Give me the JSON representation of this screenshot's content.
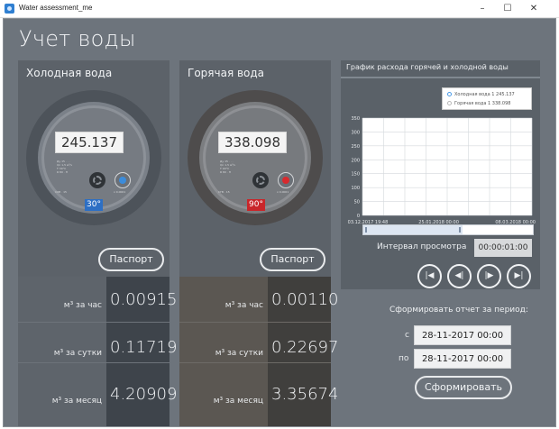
{
  "window": {
    "title": "Water assessment_me",
    "minimize": "–",
    "maximize": "☐",
    "close": "✕"
  },
  "page": {
    "title": "Учет воды"
  },
  "cold": {
    "title": "Холодная вода",
    "reading": "245.137",
    "temperature": "30°",
    "passport_label": "Паспорт",
    "stats": [
      {
        "label": "м³ за час",
        "value": "0.00915"
      },
      {
        "label": "м³ за сутки",
        "value": "0.11719"
      },
      {
        "label": "м³ за месяц",
        "value": "4.20909"
      }
    ]
  },
  "hot": {
    "title": "Горячая вода",
    "reading": "338.098",
    "temperature": "90°",
    "passport_label": "Паспорт",
    "stats": [
      {
        "label": "м³ за час",
        "value": "0.00110"
      },
      {
        "label": "м³ за сутки",
        "value": "0.22697"
      },
      {
        "label": "м³ за месяц",
        "value": "3.35674"
      }
    ]
  },
  "chart_data": {
    "type": "line",
    "title": "График расхода горячей и холодной воды",
    "xlabel": "",
    "ylabel": "",
    "x_ticks": [
      "03.12.2017 19:48",
      "25.01.2018 00:00",
      "08.03.2018 00:00"
    ],
    "y_ticks": [
      "0",
      "50",
      "100",
      "150",
      "200",
      "250",
      "300",
      "350"
    ],
    "ylim": [
      0,
      350
    ],
    "grid": true,
    "legend_position": "top-right",
    "series": [
      {
        "name": "Холодная вода 1  245.137",
        "color": "#4a9be8",
        "values": []
      },
      {
        "name": "Горячая вода 1  338.098",
        "color": "#b9b9b9",
        "values": []
      }
    ]
  },
  "interval": {
    "label": "Интервал просмотра",
    "value": "00:00:01:00"
  },
  "nav": {
    "first": "|◀",
    "prev": "◀|",
    "next": "|▶",
    "last": "▶|"
  },
  "report": {
    "title": "Сформировать отчет за период:",
    "from_label": "с",
    "from_value": "28-11-2017 00:00",
    "to_label": "по",
    "to_value": "28-11-2017 00:00",
    "button": "Сформировать"
  },
  "colors": {
    "cold_accent": "#2d6fc4",
    "hot_accent": "#c9262a",
    "cold_indicator": "#3c8cdb",
    "hot_indicator": "#d82a2e"
  }
}
